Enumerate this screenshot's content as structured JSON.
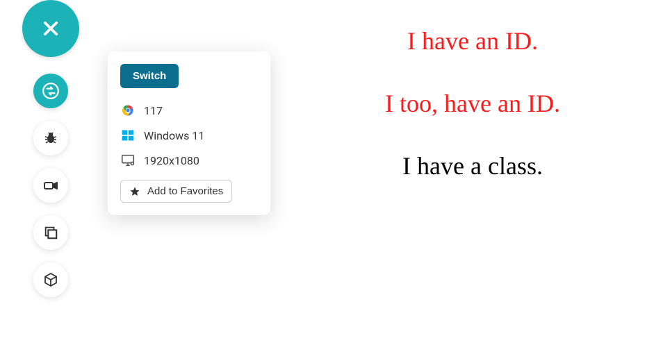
{
  "sidebar": {
    "close": "close",
    "items": [
      {
        "name": "switch-icon"
      },
      {
        "name": "bug-icon"
      },
      {
        "name": "video-icon"
      },
      {
        "name": "screenshot-icon"
      },
      {
        "name": "cube-icon"
      }
    ]
  },
  "popover": {
    "switch_label": "Switch",
    "browser_version": "117",
    "os": "Windows 11",
    "resolution": "1920x1080",
    "favorites_label": "Add to Favorites"
  },
  "content": {
    "line1": "I have an ID.",
    "line2": "I too, have an ID.",
    "line3": "I have a class."
  }
}
